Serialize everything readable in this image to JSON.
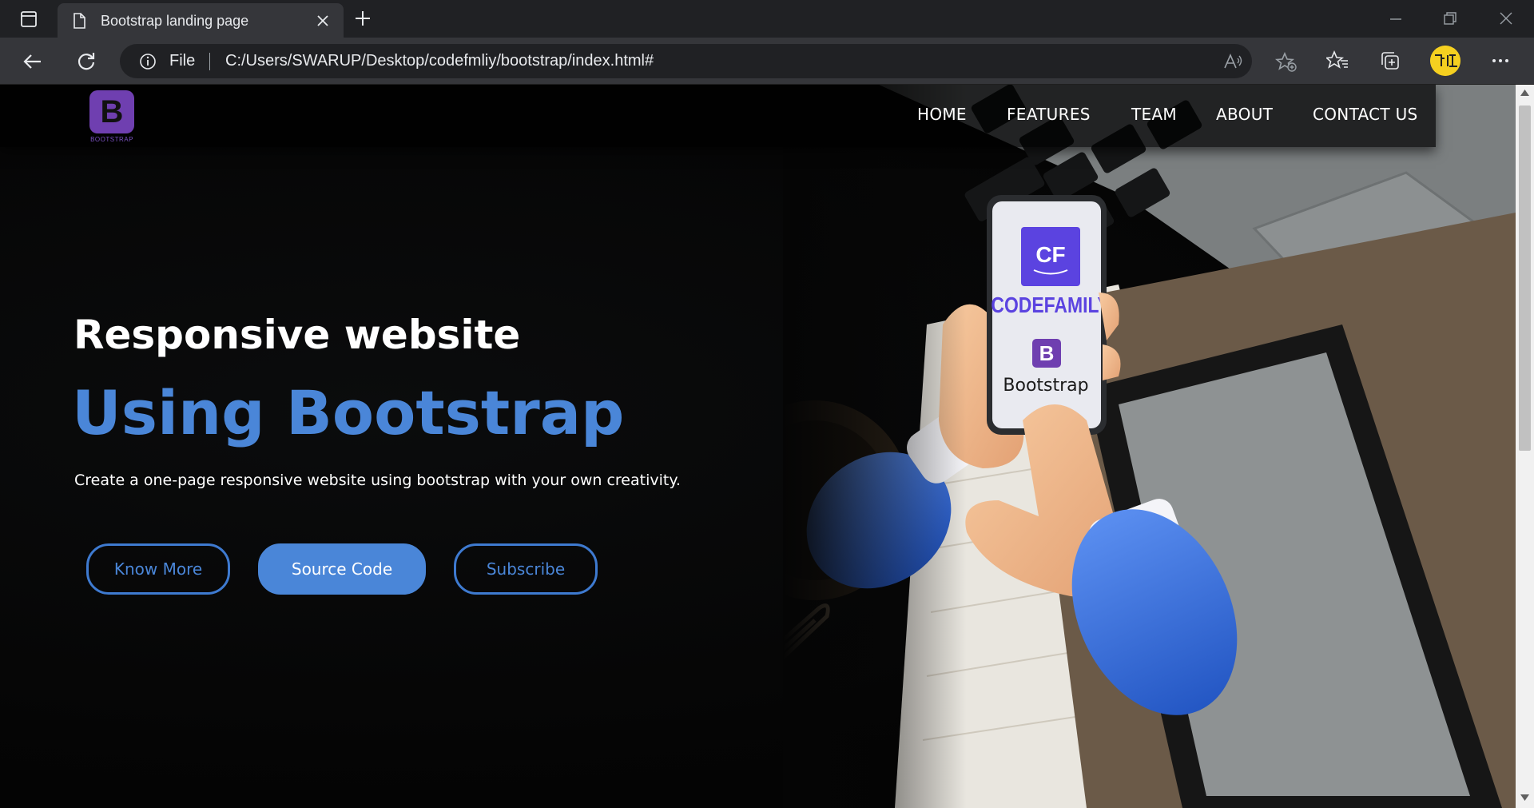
{
  "browser": {
    "tab": {
      "title": "Bootstrap landing page"
    },
    "address_bar": {
      "scheme_label": "File",
      "url": "C:/Users/SWARUP/Desktop/codefmliy/bootstrap/index.html#"
    },
    "profile_badge": "rit",
    "colors": {
      "profile": "#f5d020",
      "chrome_dark": "#202124",
      "chrome": "#35363a"
    }
  },
  "site": {
    "brand": {
      "logo_letter": "B",
      "logo_text": "BOOTSTRAP",
      "logo_color": "#6f3fb0"
    },
    "nav": [
      {
        "label": "HOME"
      },
      {
        "label": "FEATURES"
      },
      {
        "label": "TEAM"
      },
      {
        "label": "ABOUT"
      },
      {
        "label": "CONTACT US"
      }
    ],
    "hero": {
      "heading": "Responsive website",
      "subheading": "Using Bootstrap",
      "text": "Create a one-page responsive website using bootstrap with your own creativity.",
      "buttons": [
        {
          "label": "Know More",
          "style": "outline"
        },
        {
          "label": "Source Code",
          "style": "filled"
        },
        {
          "label": "Subscribe",
          "style": "outline"
        }
      ],
      "accent_color": "#4a86d8"
    },
    "phone": {
      "logo_letters": "CF",
      "logo_name": "CODEFAMILY",
      "badge_letter": "B",
      "badge_name": "Bootstrap"
    }
  }
}
